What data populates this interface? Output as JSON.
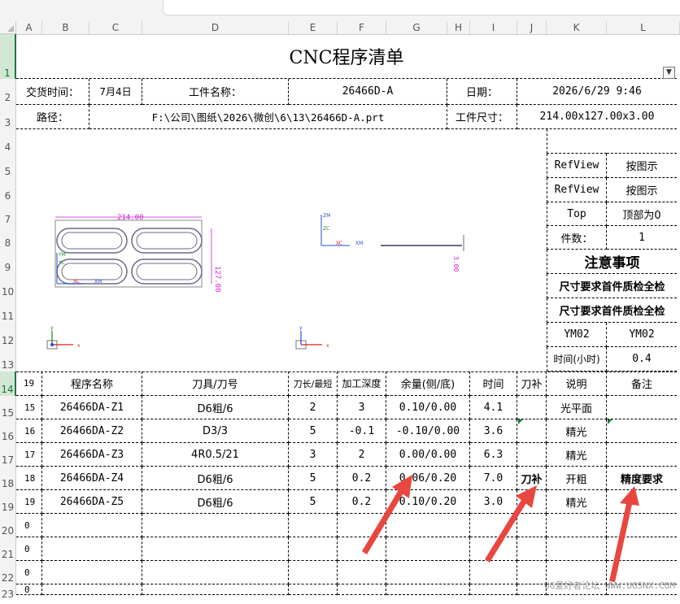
{
  "columns": [
    "A",
    "B",
    "C",
    "D",
    "E",
    "F",
    "G",
    "H",
    "I",
    "J",
    "K",
    "L"
  ],
  "rows": [
    "1",
    "2",
    "3",
    "4",
    "5",
    "6",
    "7",
    "8",
    "9",
    "10",
    "11",
    "12",
    "13",
    "14",
    "15",
    "16",
    "17",
    "18",
    "19",
    "20",
    "21",
    "22",
    "23"
  ],
  "title": "CNC程序清单",
  "header": {
    "delivery_label": "交货时间：",
    "delivery_value": "7月4日",
    "part_name_label": "工件名称：",
    "part_name_value": "26466D-A",
    "date_label": "日期：",
    "date_value": "2026/6/29 9:46",
    "path_label": "路径：",
    "path_value": "F:\\公司\\图纸\\2026\\微创\\6\\13\\26466D-A.prt",
    "size_label": "工件尺寸：",
    "size_value": "214.00x127.00x3.00"
  },
  "side_panel": {
    "refview1": "RefView",
    "refview1_val": "按图示",
    "refview2": "RefView",
    "refview2_val": "按图示",
    "top": "Top",
    "top_val": "顶部为0",
    "count_label": "件数：",
    "count_val": "1",
    "notes_title": "注意事项",
    "note1": "尺寸要求首件质检全检",
    "note2": "尺寸要求首件质检全检",
    "ym1": "YM02",
    "ym2": "YM02",
    "time_label": "时间(小时)",
    "time_val": "0.4"
  },
  "drawing": {
    "dim_width": "214.00",
    "dim_height": "127.00",
    "dim_thickness": "3.00",
    "axis_zm": "ZM",
    "axis_zc": "ZC",
    "axis_xc": "XC",
    "axis_xm": "XM",
    "axis_ym": "YM",
    "axis_yc": "YC",
    "axis_x": "x",
    "axis_y": "y"
  },
  "table": {
    "headers": [
      "19",
      "程序名称",
      "刀具/刀号",
      "刀长/最短",
      "加工深度",
      "余量(侧/底)",
      "时间",
      "刀补",
      "说明",
      "备注"
    ],
    "rows": [
      [
        "15",
        "26466DA-Z1",
        "D6粗/6",
        "2",
        "3",
        "0.10/0.00",
        "4.1",
        "",
        "光平面",
        ""
      ],
      [
        "16",
        "26466DA-Z2",
        "D3/3",
        "5",
        "-0.1",
        "-0.10/0.00",
        "3.6",
        "",
        "精光",
        ""
      ],
      [
        "17",
        "26466DA-Z3",
        "4R0.5/21",
        "3",
        "2",
        "0.00/0.00",
        "6.3",
        "",
        "精光",
        ""
      ],
      [
        "18",
        "26466DA-Z4",
        "D6粗/6",
        "5",
        "0.2",
        "0.06/0.20",
        "7.0",
        "刀补",
        "开粗",
        "精度要求"
      ],
      [
        "19",
        "26466DA-Z5",
        "D6粗/6",
        "5",
        "0.2",
        "0.10/0.20",
        "3.0",
        "",
        "精光",
        ""
      ],
      [
        "0",
        "",
        "",
        "",
        "",
        "",
        "",
        "",
        "",
        ""
      ],
      [
        "0",
        "",
        "",
        "",
        "",
        "",
        "",
        "",
        "",
        ""
      ],
      [
        "0",
        "",
        "",
        "",
        "",
        "",
        "",
        "",
        "",
        ""
      ],
      [
        "0",
        "",
        "",
        "",
        "",
        "",
        "",
        "",
        "",
        ""
      ]
    ]
  },
  "watermark": "UG爱好者论坛 WWW.UGSNX.COM",
  "colors": {
    "accent": "#217346",
    "arrow": "#e8473f",
    "magenta": "#d21fd2"
  }
}
